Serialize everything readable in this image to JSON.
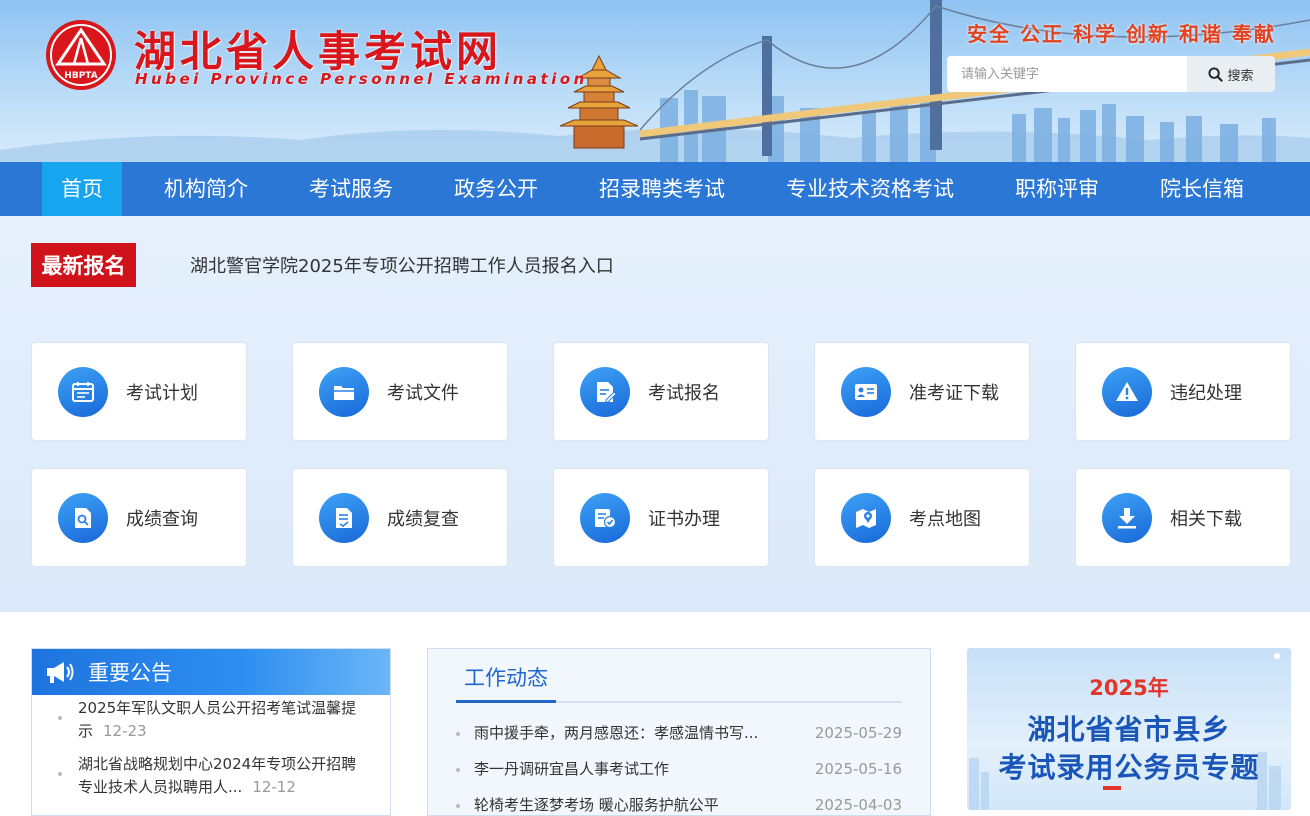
{
  "header": {
    "logo_text": "HBPTA",
    "site_name_cn": "湖北省人事考试网",
    "site_name_en": "Hubei Province Personnel Examination",
    "slogan": "安全 公正 科学 创新 和谐 奉献",
    "search": {
      "placeholder": "请输入关键字",
      "button_label": "搜索"
    }
  },
  "nav": {
    "items": [
      "首页",
      "机构简介",
      "考试服务",
      "政务公开",
      "招录聘类考试",
      "专业技术资格考试",
      "职称评审",
      "院长信箱"
    ],
    "active": "首页"
  },
  "latest": {
    "badge": "最新报名",
    "text": "湖北警官学院2025年专项公开招聘工作人员报名入口"
  },
  "services": {
    "items": [
      {
        "label": "考试计划",
        "icon": "calendar-icon"
      },
      {
        "label": "考试文件",
        "icon": "folder-icon"
      },
      {
        "label": "考试报名",
        "icon": "edit-document-icon"
      },
      {
        "label": "准考证下载",
        "icon": "id-card-icon"
      },
      {
        "label": "违纪处理",
        "icon": "warning-icon"
      },
      {
        "label": "成绩查询",
        "icon": "search-document-icon"
      },
      {
        "label": "成绩复查",
        "icon": "review-document-icon"
      },
      {
        "label": "证书办理",
        "icon": "certificate-icon"
      },
      {
        "label": "考点地图",
        "icon": "map-pin-icon"
      },
      {
        "label": "相关下载",
        "icon": "download-icon"
      }
    ]
  },
  "notice": {
    "title": "重要公告",
    "items": [
      {
        "text": "2025年军队文职人员公开招考笔试温馨提示",
        "date": "12-23"
      },
      {
        "text": "湖北省战略规划中心2024年专项公开招聘专业技术人员拟聘用人...",
        "date": "12-12"
      }
    ]
  },
  "work": {
    "tab": "工作动态",
    "items": [
      {
        "text": "雨中援手牵，两月感恩还：孝感温情书写...",
        "date": "2025-05-29"
      },
      {
        "text": "李一丹调研宜昌人事考试工作",
        "date": "2025-05-16"
      },
      {
        "text": "轮椅考生逐梦考场 暖心服务护航公平",
        "date": "2025-04-03"
      }
    ]
  },
  "banner": {
    "year": "2025年",
    "line1": "湖北省省市县乡",
    "line2": "考试录用公务员专题"
  },
  "colors": {
    "nav_bg": "#2b77d6",
    "nav_active": "#16a5ee",
    "brand_red": "#d8161b",
    "badge_red": "#d0131a",
    "accent_blue": "#1f68c9"
  }
}
